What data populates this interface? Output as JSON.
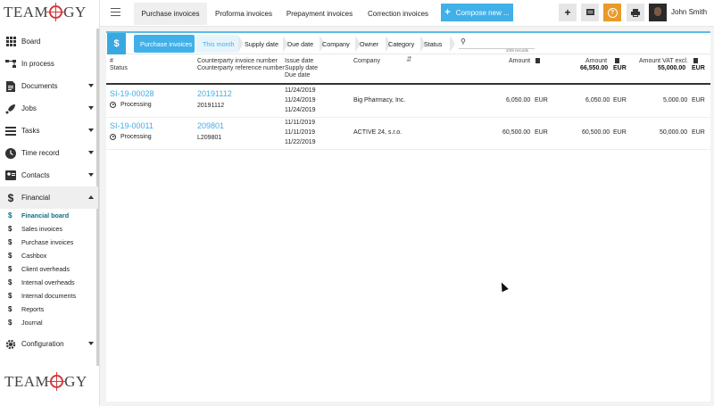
{
  "brand": {
    "logo_text_left": "TEAM",
    "logo_text_right": "GY"
  },
  "sidebar": {
    "items": [
      {
        "label": "Board"
      },
      {
        "label": "In process"
      },
      {
        "label": "Documents"
      },
      {
        "label": "Jobs"
      },
      {
        "label": "Tasks"
      },
      {
        "label": "Time record"
      },
      {
        "label": "Contacts"
      },
      {
        "label": "Financial"
      },
      {
        "label": "Configuration"
      }
    ],
    "financial_sub": [
      {
        "label": "Financial board"
      },
      {
        "label": "Sales invoices"
      },
      {
        "label": "Purchase invoices"
      },
      {
        "label": "Cashbox"
      },
      {
        "label": "Client overheads"
      },
      {
        "label": "Internal overheads"
      },
      {
        "label": "Internal documents"
      },
      {
        "label": "Reports"
      },
      {
        "label": "Journal"
      }
    ],
    "sub_icon": "$"
  },
  "topbar": {
    "tabs": [
      {
        "label": "Purchase invoices"
      },
      {
        "label": "Proforma invoices"
      },
      {
        "label": "Prepayment invoices"
      },
      {
        "label": "Correction invoices"
      }
    ],
    "compose_label": "Compose new ...",
    "help_label": "?",
    "user_name": "John Smith"
  },
  "filters": {
    "crumbs": [
      {
        "label": "Purchase invoices"
      },
      {
        "label": "This month"
      },
      {
        "label": "Supply date"
      },
      {
        "label": "Due date"
      },
      {
        "label": "Company"
      },
      {
        "label": "Owner"
      },
      {
        "label": "Category"
      },
      {
        "label": "Status"
      }
    ],
    "records": "2/29 records"
  },
  "table": {
    "headers": {
      "hash": "#",
      "status": "Status",
      "cp_invoice": "Counterparty invoice number",
      "cp_reference": "Counterparty reference number",
      "issue_date": "Issue date",
      "supply_date": "Supply date",
      "due_date": "Due date",
      "company": "Company",
      "amount": "Amount",
      "amount2": "Amount",
      "amount2_total": "66,550.00",
      "amount2_currency": "EUR",
      "vat_excl": "Amount VAT excl.",
      "vat_excl_total": "55,000.00",
      "vat_excl_currency": "EUR"
    },
    "rows": [
      {
        "id": "SI-19-00028",
        "status": "Processing",
        "cp_invoice": "20191112",
        "cp_reference": "20191112",
        "issue_date": "11/24/2019",
        "supply_date": "11/24/2019",
        "due_date": "11/24/2019",
        "company": "Big Pharmacy, Inc.",
        "amount": "6,050.00",
        "currency": "EUR",
        "amount2": "6,050.00",
        "currency2": "EUR",
        "vat_excl": "5,000.00",
        "currency3": "EUR"
      },
      {
        "id": "SI-19-00011",
        "status": "Processing",
        "cp_invoice": "209801",
        "cp_reference": "L209801",
        "issue_date": "11/11/2019",
        "supply_date": "11/11/2019",
        "due_date": "11/22/2019",
        "company": "ACTIVE 24, s.r.o.",
        "amount": "60,500.00",
        "currency": "EUR",
        "amount2": "60,500.00",
        "currency2": "EUR",
        "vat_excl": "50,000.00",
        "currency3": "EUR"
      }
    ]
  },
  "colors": {
    "accent": "#41b0e8",
    "active_sub": "#0e6f86",
    "help": "#e89a2b"
  }
}
